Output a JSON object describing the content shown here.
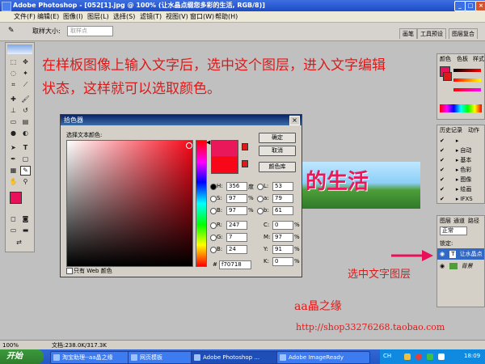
{
  "titlebar": {
    "title": "Adobe Photoshop - [052[1].jpg @ 100% (让水晶点缀您多彩的生活, RGB/8)]",
    "min": "_",
    "max": "□",
    "close": "×"
  },
  "menu": [
    "文件(F)",
    "编辑(E)",
    "图像(I)",
    "图层(L)",
    "选择(S)",
    "滤镜(T)",
    "视图(V)",
    "窗口(W)",
    "帮助(H)"
  ],
  "options": {
    "sample_label": "取样大小:",
    "sample_value": "取样点"
  },
  "workspace_tabs": [
    "画笔",
    "工具预设",
    "图层复合"
  ],
  "annotation": {
    "line1": "在样板图像上输入文字后，选中这个图层，进入文字编辑",
    "line2": "状态，这样就可以选取颜色。",
    "select_layer": "选中文字图层",
    "shop_name": "aa晶之缘",
    "url": "http://shop33276268.taobao.com"
  },
  "canvas_text": "的生活",
  "dialog": {
    "title": "拾色器",
    "subtitle": "选择文本颜色:",
    "ok": "确定",
    "cancel": "取消",
    "library": "颜色库",
    "web_only": "只有 Web 颜色",
    "fields": {
      "H": "356",
      "H_unit": "度",
      "S": "97",
      "B": "97",
      "pct": "%",
      "R": "247",
      "G": "7",
      "Bl": "24",
      "L": "53",
      "a": "79",
      "b": "61",
      "C": "0",
      "M": "97",
      "Y": "91",
      "K": "0",
      "hex": "f70718"
    },
    "labels": {
      "H": "H:",
      "S": "S:",
      "B": "B:",
      "R": "R:",
      "G": "G:",
      "Bl": "B:",
      "L": "L:",
      "a": "a:",
      "b": "b:",
      "C": "C:",
      "M": "M:",
      "Y": "Y:",
      "K": "K:",
      "hash": "#"
    }
  },
  "panels": {
    "color_tabs": [
      "颜色",
      "色板",
      "样式"
    ],
    "history_tabs": [
      "历史记录",
      "动作"
    ],
    "history_items": [
      "自动",
      "基本",
      "色彩",
      "图像",
      "绘画",
      "IFXS"
    ],
    "layers_tabs": [
      "图层",
      "通道",
      "路径"
    ],
    "blend_mode": "正常",
    "lock_label": "锁定:",
    "layer_text": "让水晶点",
    "layer_bg": "背景"
  },
  "statusbar": {
    "zoom": "100%",
    "doc": "文档:238.0K/317.3K"
  },
  "taskbar": {
    "start": "开始",
    "items": [
      "淘宝助理--aa晶之缘",
      "网页模板",
      "Adobe Photoshop ...",
      "Adobe ImageReady"
    ],
    "lang": "CH",
    "time": "18:09"
  },
  "colors": {
    "foreground": "#f70718",
    "new": "#e8185a",
    "accent": "#e01818",
    "magenta": "#e8105a"
  }
}
